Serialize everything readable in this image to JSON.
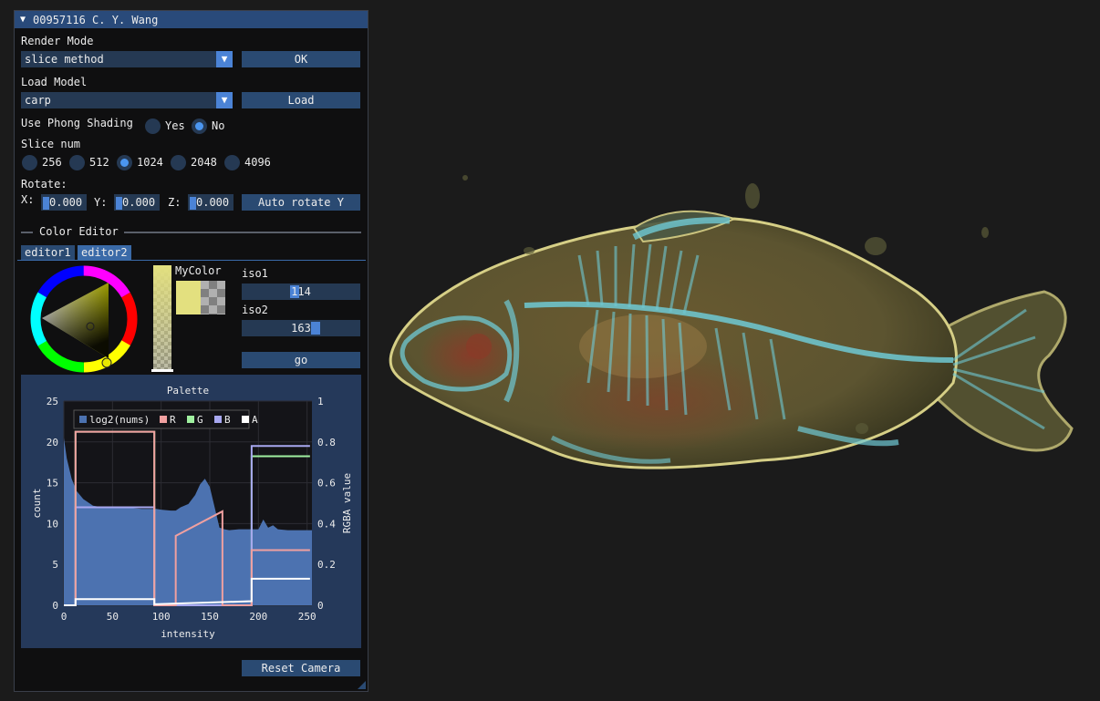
{
  "window": {
    "title": "00957116 C. Y. Wang",
    "collapse_icon": "triangle-down-icon"
  },
  "render_mode": {
    "label": "Render Mode",
    "value": "slice method",
    "button": "OK"
  },
  "load_model": {
    "label": "Load Model",
    "value": "carp",
    "button": "Load"
  },
  "phong": {
    "label": "Use Phong Shading",
    "options": [
      "Yes",
      "No"
    ],
    "selected": "No"
  },
  "slice": {
    "label": "Slice num",
    "options": [
      "256",
      "512",
      "1024",
      "2048",
      "4096"
    ],
    "selected": "1024"
  },
  "rotate": {
    "label": "Rotate:",
    "x_label": "X:",
    "x_value": "0.000",
    "y_label": "Y:",
    "y_value": "0.000",
    "z_label": "Z:",
    "z_value": "0.000",
    "button": "Auto rotate Y"
  },
  "color_editor": {
    "title": "Color Editor",
    "tabs": [
      "editor1",
      "editor2"
    ],
    "active_tab": "editor2",
    "my_color_label": "MyColor",
    "my_color": "#e3e07f",
    "iso1": {
      "label": "iso1",
      "value": "114"
    },
    "iso2": {
      "label": "iso2",
      "value": "163"
    },
    "go_button": "go"
  },
  "palette": {
    "title": "Palette",
    "xlabel": "intensity",
    "ylabel_left": "count",
    "ylabel_right": "RGBA value",
    "x_ticks": [
      "0",
      "50",
      "100",
      "150",
      "200",
      "250"
    ],
    "y_ticks_left": [
      "0",
      "5",
      "10",
      "15",
      "20",
      "25"
    ],
    "y_ticks_right": [
      "0",
      "0.2",
      "0.4",
      "0.6",
      "0.8",
      "1"
    ],
    "legend": [
      "log2(nums)",
      "R",
      "G",
      "B",
      "A"
    ]
  },
  "chart_data": {
    "type": "area",
    "title": "Palette",
    "xlabel": "intensity",
    "ylabel": "count",
    "y2label": "RGBA value",
    "xlim": [
      0,
      255
    ],
    "ylim": [
      0,
      25
    ],
    "y2lim": [
      0,
      1
    ],
    "legend_position": "top-left",
    "colors": {
      "log2(nums)": "#4c72b0",
      "R": "#f0a0a0",
      "G": "#a0f0a0",
      "B": "#a8a8f0",
      "A": "#ffffff"
    },
    "histogram": {
      "name": "log2(nums)",
      "x": [
        0,
        3,
        8,
        13,
        20,
        30,
        40,
        50,
        60,
        70,
        80,
        90,
        95,
        100,
        110,
        115,
        120,
        128,
        135,
        140,
        145,
        150,
        155,
        160,
        165,
        170,
        180,
        190,
        200,
        205,
        210,
        215,
        220,
        230,
        240,
        250,
        255
      ],
      "y": [
        20.5,
        18,
        15.5,
        14,
        13,
        12.2,
        12,
        11.9,
        11.9,
        11.9,
        11.8,
        11.8,
        11.8,
        11.7,
        11.6,
        11.6,
        12,
        12.4,
        13.5,
        14.8,
        15.5,
        14.5,
        12,
        9.5,
        9.3,
        9.2,
        9.3,
        9.3,
        9.3,
        10.5,
        9.5,
        9.8,
        9.3,
        9.2,
        9.2,
        9.2,
        9.2
      ]
    },
    "series": [
      {
        "name": "R",
        "x": [
          0,
          12,
          12,
          93,
          93,
          115,
          115,
          163,
          163,
          193,
          193,
          253
        ],
        "y": [
          0,
          0,
          0.85,
          0.85,
          0,
          0,
          0.34,
          0.46,
          0,
          0,
          0.27,
          0.27
        ]
      },
      {
        "name": "G",
        "x": [
          0,
          12,
          12,
          93,
          93,
          193,
          193,
          253
        ],
        "y": [
          0,
          0,
          0.85,
          0.85,
          0,
          0,
          0.73,
          0.73
        ]
      },
      {
        "name": "B",
        "x": [
          0,
          12,
          12,
          93,
          93,
          193,
          193,
          253
        ],
        "y": [
          0,
          0,
          0.48,
          0.48,
          0,
          0,
          0.78,
          0.78
        ]
      },
      {
        "name": "A",
        "x": [
          0,
          12,
          12,
          93,
          93,
          193,
          193,
          253
        ],
        "y": [
          0,
          0,
          0.03,
          0.03,
          0.005,
          0.02,
          0.13,
          0.13
        ]
      }
    ]
  },
  "reset_camera": "Reset Camera"
}
